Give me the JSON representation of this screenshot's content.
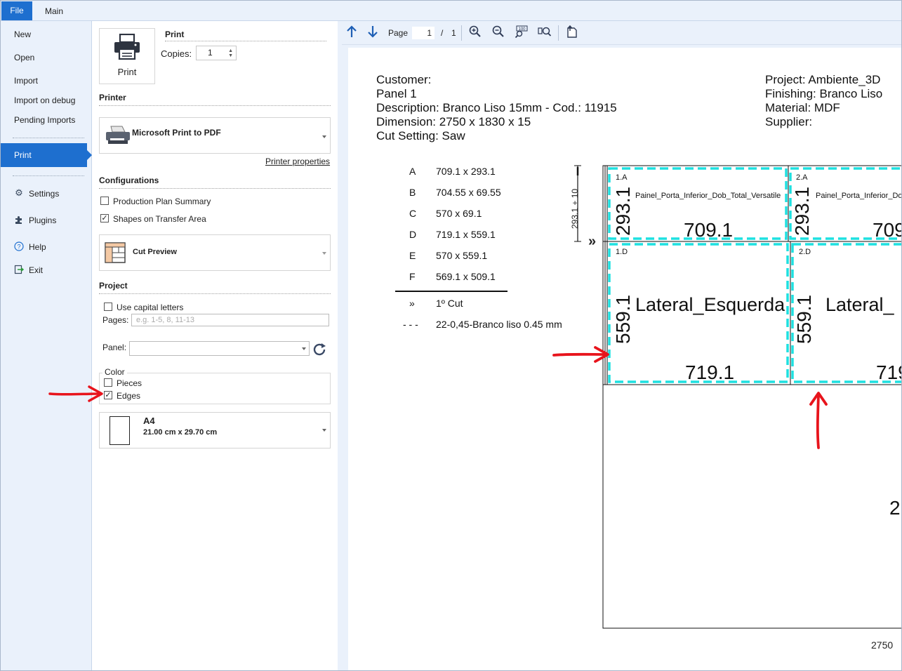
{
  "ribbon": {
    "tabs": [
      "File",
      "Main"
    ]
  },
  "file_menu": {
    "items_top": [
      "New",
      "Open",
      "Import",
      "Import on debug",
      "Pending Imports"
    ],
    "active": "Print",
    "items_bottom": [
      {
        "label": "Settings",
        "icon": "gear-icon"
      },
      {
        "label": "Plugins",
        "icon": "puzzle-icon"
      },
      {
        "label": "Help",
        "icon": "help-icon"
      },
      {
        "label": "Exit",
        "icon": "exit-icon"
      }
    ]
  },
  "print_panel": {
    "print_section_title": "Print",
    "print_button_label": "Print",
    "copies_label": "Copies:",
    "copies_value": "1",
    "printer_title": "Printer",
    "printer_name": "Microsoft Print to PDF",
    "printer_properties_link": "Printer properties",
    "configurations_title": "Configurations",
    "config_options": [
      {
        "label": "Production Plan Summary",
        "checked": false
      },
      {
        "label": "Shapes on Transfer Area",
        "checked": true
      }
    ],
    "layout_selected": "Cut Preview",
    "project_title": "Project",
    "use_capital_letters_label": "Use capital letters",
    "use_capital_letters_checked": false,
    "pages_label": "Pages:",
    "pages_placeholder": "e.g. 1-5, 8, 11-13",
    "panel_label": "Panel:",
    "panel_value": "",
    "color_group_title": "Color",
    "color_options": [
      {
        "label": "Pieces",
        "checked": false
      },
      {
        "label": "Edges",
        "checked": true
      }
    ],
    "paper_name": "A4",
    "paper_size": "21.00 cm x 29.70 cm"
  },
  "preview_toolbar": {
    "page_label": "Page",
    "page_current": "1",
    "page_separator": "/",
    "page_total": "1",
    "icons": [
      "arrow-up-icon",
      "arrow-down-icon",
      "zoom-in-icon",
      "zoom-out-icon",
      "zoom-100-icon",
      "zoom-fit-icon",
      "export-icon"
    ]
  },
  "document": {
    "header_left": [
      "Customer:",
      "Panel 1",
      "Description: Branco Liso 15mm - Cod.: 11915",
      "Dimension: 2750 x 1830 x 15",
      "Cut Setting: Saw"
    ],
    "header_right": [
      "Project: Ambiente_3D",
      "Finishing: Branco Liso",
      "Material: MDF",
      "Supplier:"
    ],
    "legend": [
      {
        "key": "A",
        "value": "709.1 x 293.1"
      },
      {
        "key": "B",
        "value": "704.55 x 69.55"
      },
      {
        "key": "C",
        "value": "570 x 69.1"
      },
      {
        "key": "D",
        "value": "719.1 x 559.1"
      },
      {
        "key": "E",
        "value": "570 x 559.1"
      },
      {
        "key": "F",
        "value": "569.1 x 509.1"
      }
    ],
    "legend_notes": [
      {
        "key": "»",
        "value": "1º Cut"
      },
      {
        "key": "- - -",
        "value": "22-0,45-Branco liso  0.45 mm"
      }
    ],
    "strip_dimension": "293.1 + 10",
    "cut_marker": "»",
    "pieces": [
      {
        "id": "1.A",
        "name": "Painel_Porta_Inferior_Dob_Total_Versatile",
        "width": "709.1",
        "height": "293.1"
      },
      {
        "id": "2.A",
        "name": "Painel_Porta_Inferior_Do",
        "width": "709",
        "height": "293.1"
      },
      {
        "id": "1.D",
        "name": "Lateral_Esquerda",
        "width": "719.1",
        "height": "559.1"
      },
      {
        "id": "2.D",
        "name": "Lateral_",
        "width": "719",
        "height": "559.1"
      }
    ],
    "edge_color": "#1ee0e0",
    "partial_label_right": "2",
    "panel_length_label": "2750"
  },
  "annotation_color": "#e8141c"
}
